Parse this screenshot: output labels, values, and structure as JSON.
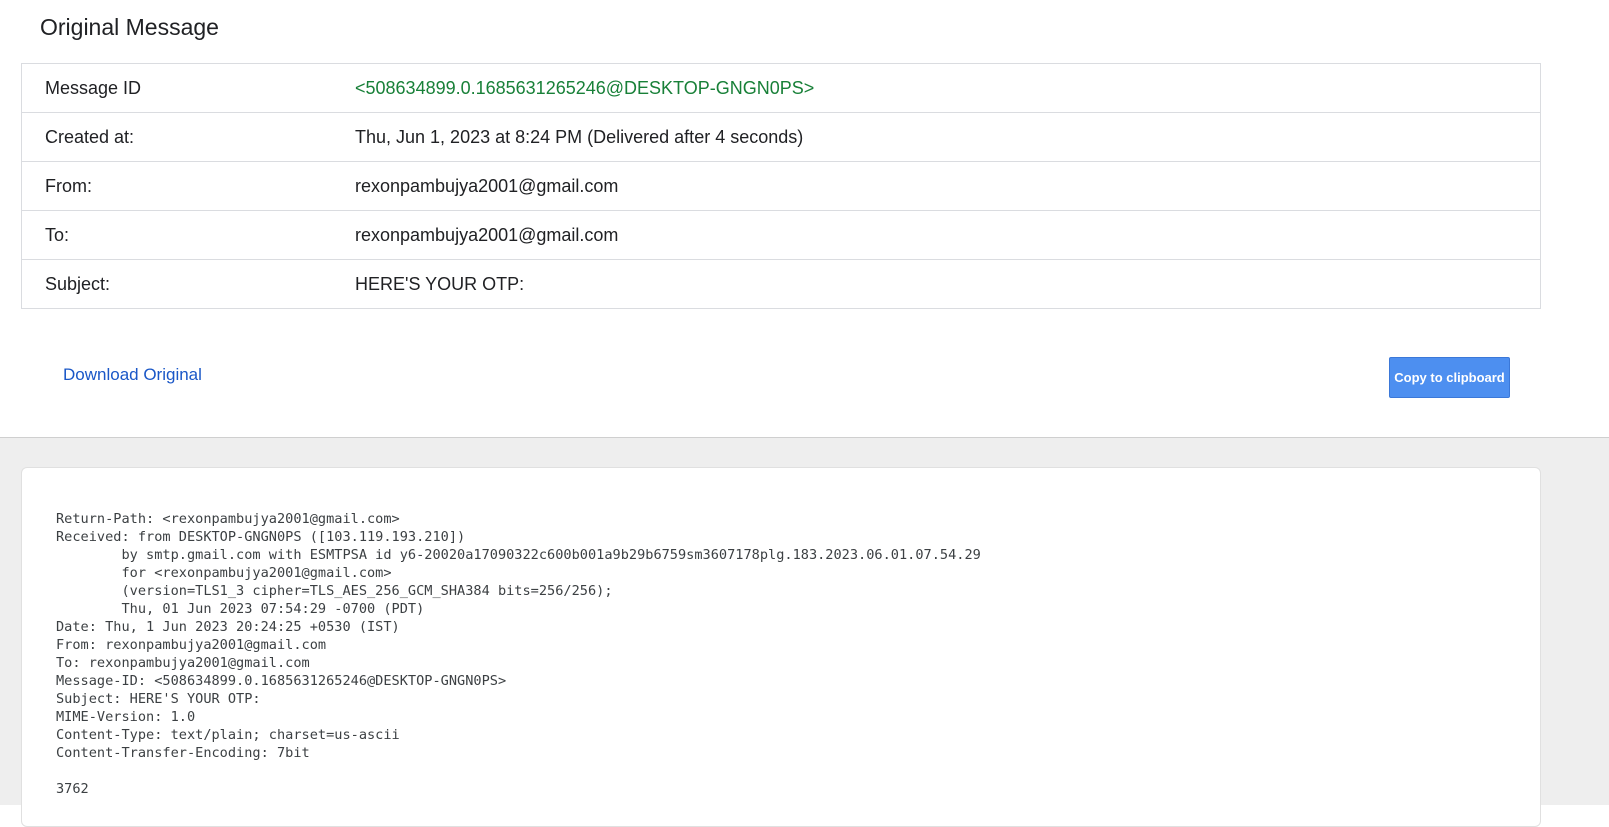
{
  "page": {
    "title": "Original Message"
  },
  "details": [
    {
      "label": "Message ID",
      "value": "<508634899.0.1685631265246@DESKTOP-GNGN0PS>"
    },
    {
      "label": "Created at:",
      "value": "Thu, Jun 1, 2023 at 8:24 PM (Delivered after 4 seconds)"
    },
    {
      "label": "From:",
      "value": "rexonpambujya2001@gmail.com"
    },
    {
      "label": "To:",
      "value": "rexonpambujya2001@gmail.com"
    },
    {
      "label": "Subject:",
      "value": "HERE'S YOUR OTP:"
    }
  ],
  "actions": {
    "download_label": "Download Original",
    "copy_label": "Copy to clipboard"
  },
  "raw_message": "Return-Path: <rexonpambujya2001@gmail.com>\nReceived: from DESKTOP-GNGN0PS ([103.119.193.210])\n        by smtp.gmail.com with ESMTPSA id y6-20020a17090322c600b001a9b29b6759sm3607178plg.183.2023.06.01.07.54.29\n        for <rexonpambujya2001@gmail.com>\n        (version=TLS1_3 cipher=TLS_AES_256_GCM_SHA384 bits=256/256);\n        Thu, 01 Jun 2023 07:54:29 -0700 (PDT)\nDate: Thu, 1 Jun 2023 20:24:25 +0530 (IST)\nFrom: rexonpambujya2001@gmail.com\nTo: rexonpambujya2001@gmail.com\nMessage-ID: <508634899.0.1685631265246@DESKTOP-GNGN0PS>\nSubject: HERE'S YOUR OTP:\nMIME-Version: 1.0\nContent-Type: text/plain; charset=us-ascii\nContent-Transfer-Encoding: 7bit\n\n3762",
  "colors": {
    "message_id": "#188038",
    "link": "#1a57c7",
    "button": "#4d8ff0",
    "bottom_background": "#eeeeee"
  }
}
